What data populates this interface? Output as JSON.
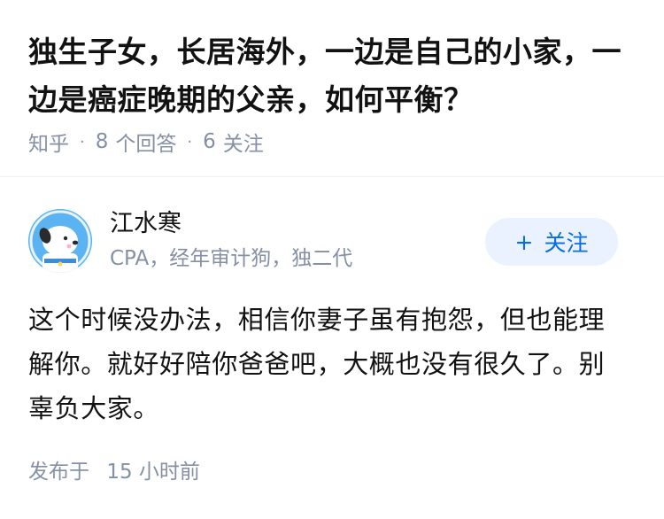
{
  "question": {
    "title": "独生子女，长居海外，一边是自己的小家，一边是癌症晚期的父亲，如何平衡？",
    "source": "知乎",
    "answer_count": "8",
    "answer_label": "个回答",
    "follower_count": "6",
    "follower_label": "关注",
    "separator": "·"
  },
  "answer": {
    "author": {
      "name": "江水寒",
      "bio": "CPA，经年审计狗，独二代",
      "avatar_icon": "cartoon-dog-avatar-icon"
    },
    "follow_button": {
      "plus": "+",
      "label": "关注"
    },
    "content": "这个时候没办法，相信你妻子虽有抱怨，但也能理解你。就好好陪你爸爸吧，大概也没有很久了。别辜负大家。",
    "published": {
      "label": "发布于",
      "time": "15 小时前"
    }
  },
  "colors": {
    "title": "#121212",
    "meta": "#8590a6",
    "accent": "#056de8",
    "follow_bg": "#eaf2ff",
    "avatar_bg": "#60b4f0"
  }
}
